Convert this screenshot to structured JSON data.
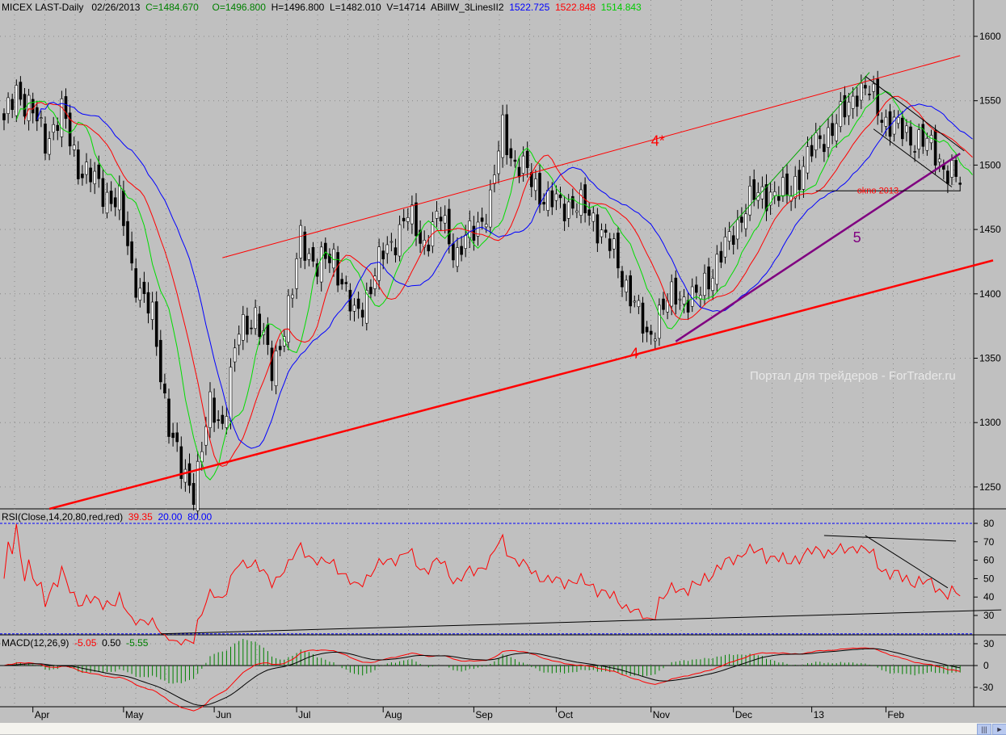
{
  "header": {
    "symbol": "MICEX LAST-Daily",
    "date": "02/26/2013",
    "close": "C=1484.670",
    "open": "O=1496.800",
    "high": "H=1496.800",
    "low": "L=1482.010",
    "volume": "V=14714",
    "indicator": "ABillW_3LinesII2",
    "ind_blue": "1522.725",
    "ind_red": "1522.848",
    "ind_green": "1514.843"
  },
  "rsi_header": {
    "label": "RSI(Close,14,20,80,red,red)",
    "value": "39.35",
    "low": "20.00",
    "high": "80.00"
  },
  "macd_header": {
    "label": "MACD(12,26,9)",
    "macd": "-5.05",
    "signal": "0.50",
    "hist": "-5.55"
  },
  "watermark": "Портал для трейдеров - ForTrader.ru",
  "colors": {
    "bg": "#c0c0c0",
    "fast": "#00dd00",
    "mid": "#ff0000",
    "slow": "#0000ff",
    "trend": "#ff0000",
    "purple": "#800080",
    "macd_hist": "#008000"
  },
  "chart_data": {
    "type": "candlestick",
    "title": "MICEX LAST-Daily",
    "price_axis": {
      "ticks": [
        1250,
        1300,
        1350,
        1400,
        1450,
        1500,
        1550,
        1600
      ],
      "ylim": [
        1220,
        1630
      ]
    },
    "rsi_axis": {
      "ticks": [
        30,
        40,
        50,
        60,
        70,
        80
      ],
      "levels": [
        20,
        80
      ]
    },
    "macd_axis": {
      "ticks": [
        30,
        0,
        -30
      ]
    },
    "months": [
      {
        "label": "Apr",
        "bar": 7
      },
      {
        "label": "May",
        "bar": 29
      },
      {
        "label": "Jun",
        "bar": 51
      },
      {
        "label": "Jul",
        "bar": 71
      },
      {
        "label": "Aug",
        "bar": 92
      },
      {
        "label": "Sep",
        "bar": 114
      },
      {
        "label": "Oct",
        "bar": 134
      },
      {
        "label": "Nov",
        "bar": 157
      },
      {
        "label": "Dec",
        "bar": 177
      },
      {
        "label": "13",
        "bar": 196
      },
      {
        "label": "Feb",
        "bar": 214
      }
    ],
    "close_anchors": [
      [
        0,
        1530
      ],
      [
        3,
        1560
      ],
      [
        6,
        1545
      ],
      [
        10,
        1520
      ],
      [
        14,
        1540
      ],
      [
        18,
        1500
      ],
      [
        24,
        1480
      ],
      [
        28,
        1470
      ],
      [
        31,
        1420
      ],
      [
        36,
        1380
      ],
      [
        40,
        1300
      ],
      [
        43,
        1260
      ],
      [
        46,
        1250
      ],
      [
        50,
        1310
      ],
      [
        53,
        1300
      ],
      [
        57,
        1370
      ],
      [
        61,
        1385
      ],
      [
        65,
        1340
      ],
      [
        70,
        1400
      ],
      [
        72,
        1445
      ],
      [
        76,
        1420
      ],
      [
        80,
        1430
      ],
      [
        85,
        1380
      ],
      [
        88,
        1400
      ],
      [
        92,
        1430
      ],
      [
        98,
        1460
      ],
      [
        102,
        1440
      ],
      [
        106,
        1460
      ],
      [
        110,
        1430
      ],
      [
        114,
        1450
      ],
      [
        118,
        1470
      ],
      [
        121,
        1530
      ],
      [
        124,
        1500
      ],
      [
        128,
        1490
      ],
      [
        132,
        1470
      ],
      [
        138,
        1470
      ],
      [
        143,
        1460
      ],
      [
        148,
        1430
      ],
      [
        152,
        1400
      ],
      [
        156,
        1365
      ],
      [
        159,
        1385
      ],
      [
        163,
        1400
      ],
      [
        168,
        1395
      ],
      [
        172,
        1420
      ],
      [
        176,
        1440
      ],
      [
        180,
        1470
      ],
      [
        186,
        1480
      ],
      [
        190,
        1475
      ],
      [
        194,
        1500
      ],
      [
        198,
        1520
      ],
      [
        203,
        1535
      ],
      [
        207,
        1560
      ],
      [
        210,
        1555
      ],
      [
        214,
        1535
      ],
      [
        218,
        1525
      ],
      [
        222,
        1520
      ],
      [
        226,
        1510
      ],
      [
        229,
        1495
      ],
      [
        232,
        1485
      ]
    ],
    "trendlines": [
      {
        "name": "support-4",
        "color": "#ff0000",
        "width": 2.5,
        "from": [
          11,
          1233
        ],
        "to": [
          240,
          1426
        ]
      },
      {
        "name": "resistance-4star",
        "color": "#ff0000",
        "width": 1,
        "from": [
          53,
          1428
        ],
        "to": [
          232,
          1585
        ]
      },
      {
        "name": "support-5",
        "color": "#800080",
        "width": 2.5,
        "from": [
          163,
          1363
        ],
        "to": [
          232,
          1509
        ]
      },
      {
        "name": "channel-up",
        "color": "#00aa00",
        "width": 1,
        "from": [
          176,
          1451
        ],
        "to": [
          210,
          1572
        ]
      },
      {
        "name": "channel-down-top",
        "color": "#000000",
        "width": 1,
        "from": [
          209,
          1569
        ],
        "to": [
          233,
          1511
        ]
      },
      {
        "name": "channel-down-bottom",
        "color": "#000000",
        "width": 1,
        "from": [
          211,
          1528
        ],
        "to": [
          230,
          1483
        ]
      },
      {
        "name": "okno-level",
        "color": "#000000",
        "width": 1,
        "from": [
          197,
          1480
        ],
        "to": [
          232,
          1480
        ]
      }
    ],
    "labels": [
      {
        "text": "4",
        "bar": 152,
        "price": 1350,
        "color": "#ff0000"
      },
      {
        "text": "4*",
        "bar": 157,
        "price": 1515,
        "color": "#ff0000"
      },
      {
        "text": "5",
        "bar": 206,
        "price": 1440,
        "color": "#800080"
      },
      {
        "text": "okno 2013",
        "bar": 207,
        "price": 1478,
        "color": "#ff0000"
      }
    ],
    "rsi_trendlines": [
      {
        "from": [
          38,
          20
        ],
        "to": [
          242,
          33
        ]
      },
      {
        "from": [
          199,
          73.4
        ],
        "to": [
          231,
          70.4
        ]
      },
      {
        "from": [
          209,
          73.4
        ],
        "to": [
          229,
          45
        ]
      }
    ]
  }
}
